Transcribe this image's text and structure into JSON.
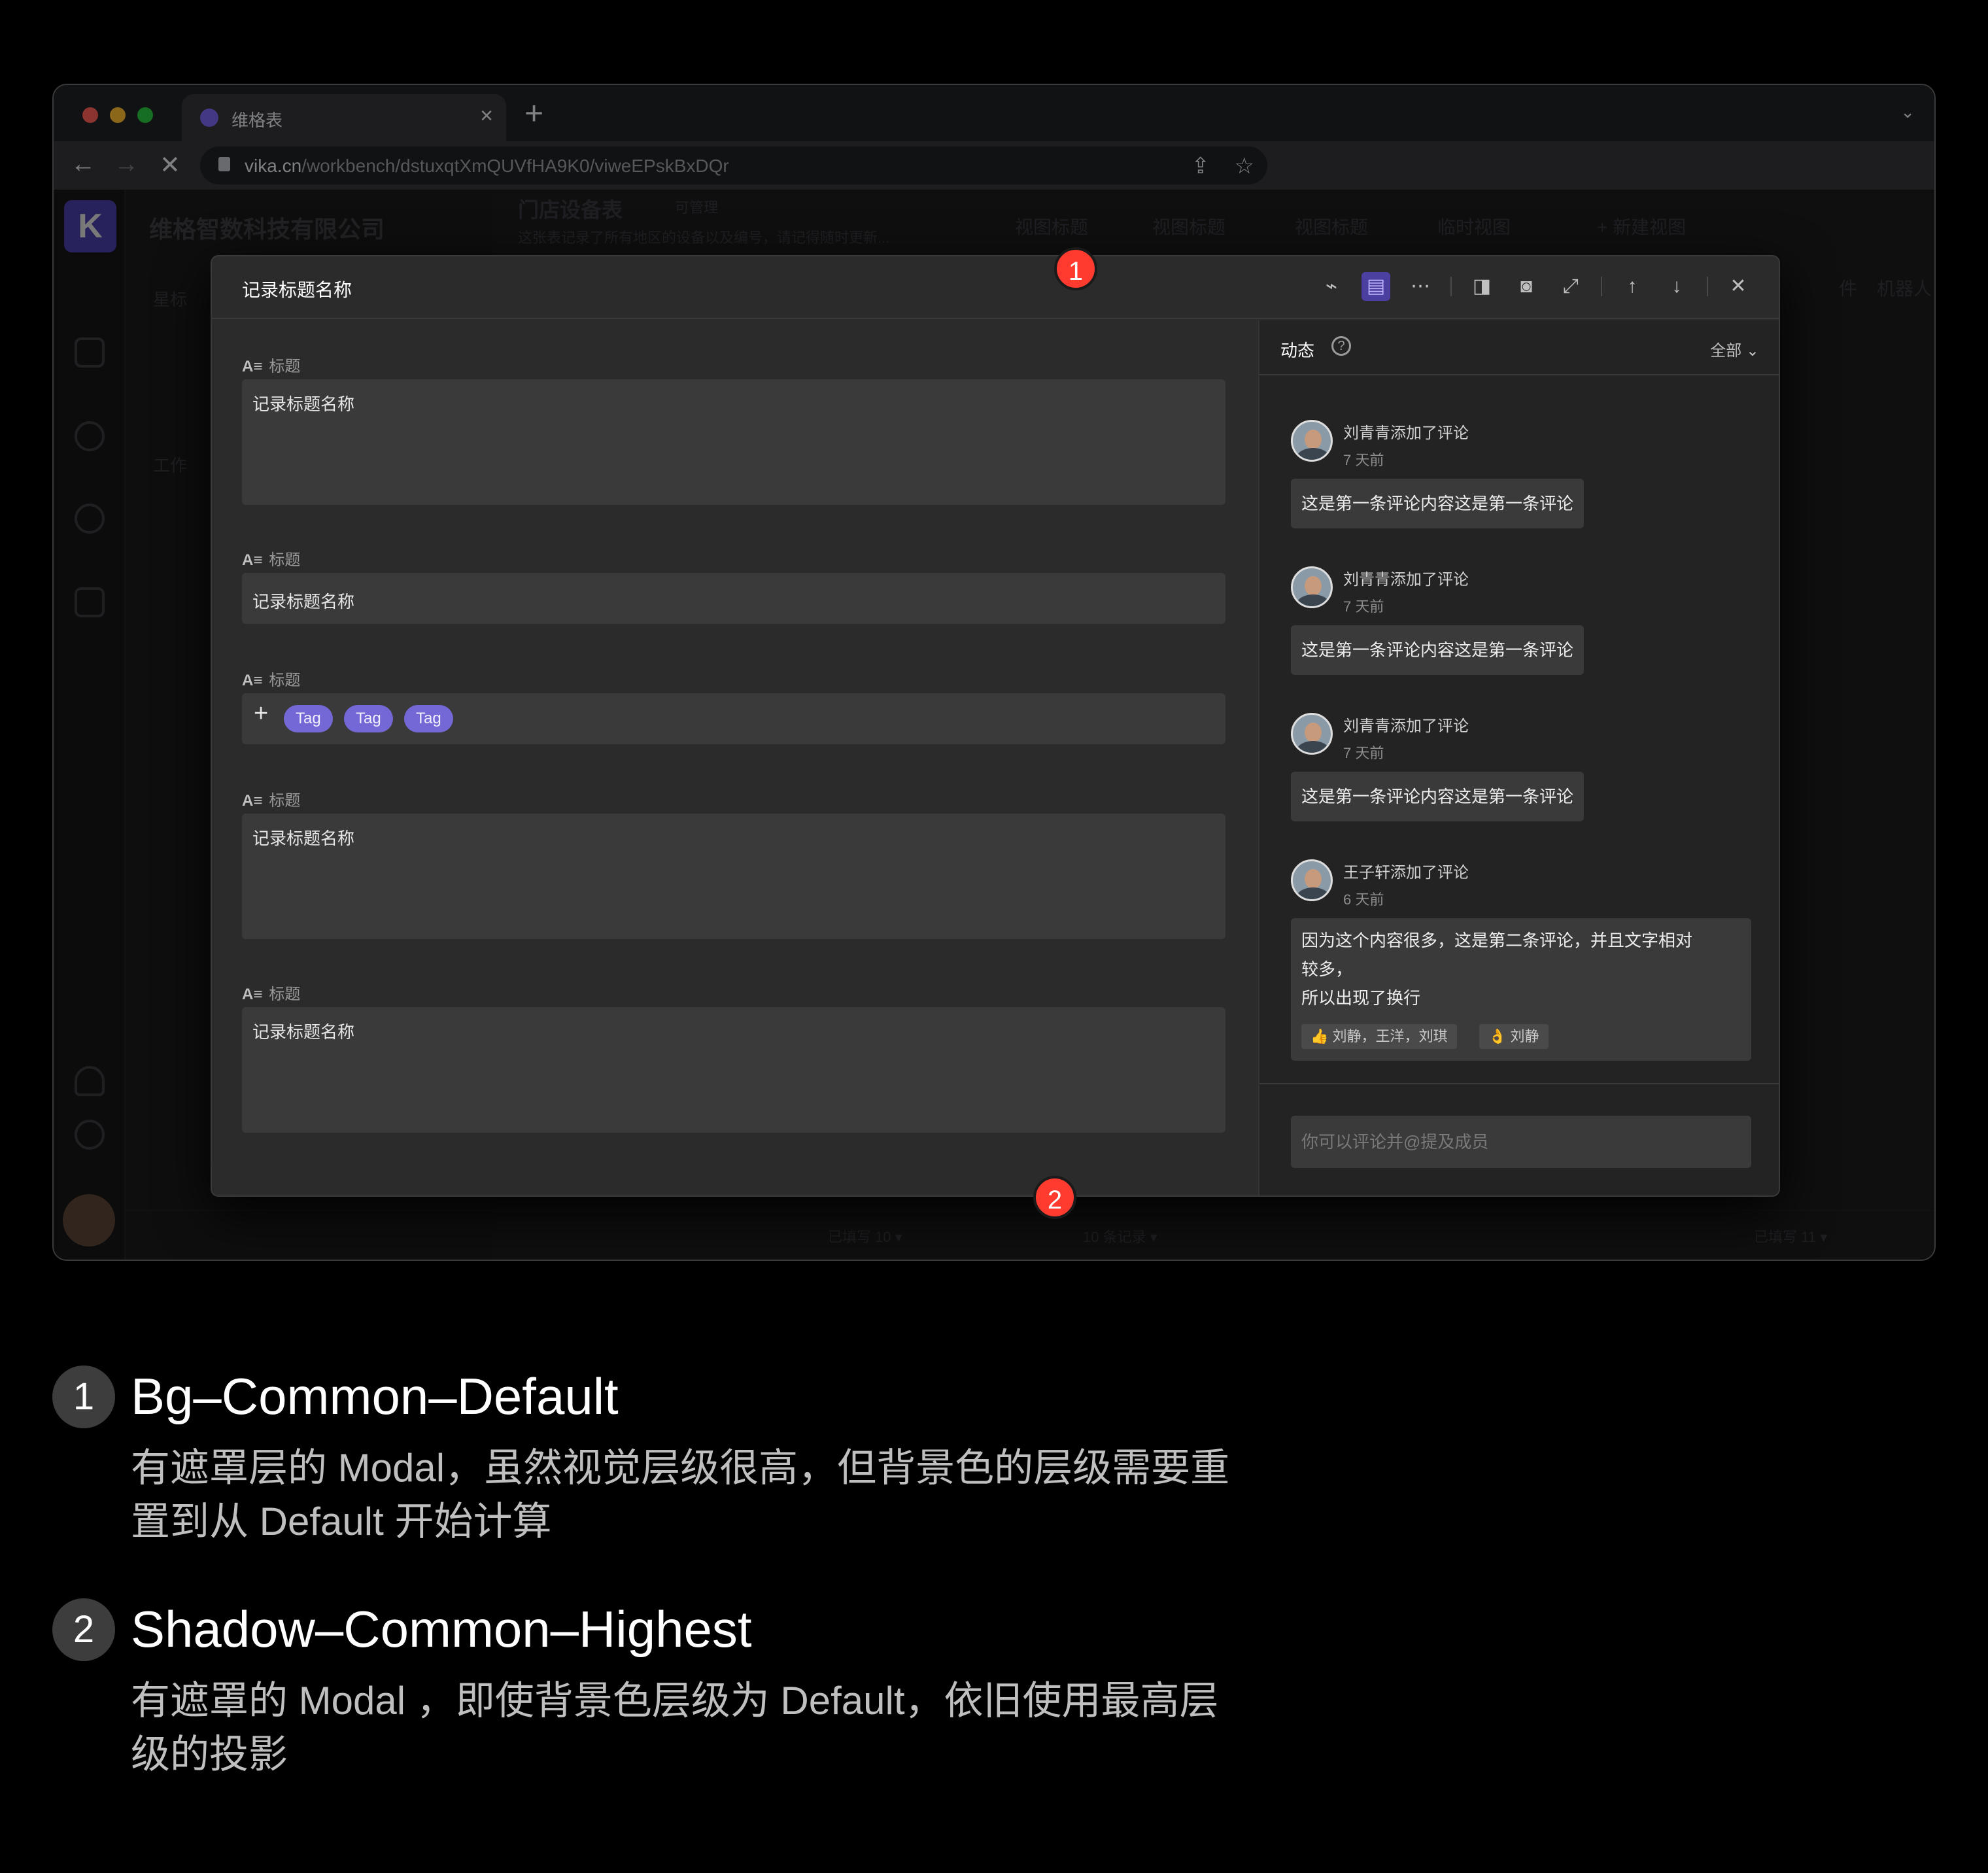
{
  "browser": {
    "tab_title": "维格表",
    "url_host": "vika.cn",
    "url_path": "/workbench/dstuxqtXmQUVfHA9K0/viweEPskBxDQr",
    "light_colors": [
      "#ff5f57",
      "#febc2e",
      "#28c840"
    ]
  },
  "app": {
    "org_name": "维格智数科技有限公司",
    "sidebar_starred": "星标",
    "sidebar_workspace": "工作",
    "sheet_title": "门店设备表",
    "sheet_permission": "可管理",
    "sheet_desc": "这张表记录了所有地区的设备以及编号，请记得随时更新...",
    "views": [
      "视图标题",
      "视图标题",
      "视图标题",
      "临时视图"
    ],
    "new_view": "+ 新建视图",
    "robot": "机器人",
    "attachment": "件",
    "footer_left": "已填写 10 ▾",
    "footer_mid": "10 条记录 ▾",
    "footer_right": "已填写 11 ▾"
  },
  "modal": {
    "title": "记录标题名称",
    "fields": [
      {
        "label": "标题",
        "value": "记录标题名称"
      },
      {
        "label": "标题",
        "value": "记录标题名称"
      },
      {
        "label": "标题",
        "tags": [
          "Tag",
          "Tag",
          "Tag"
        ]
      },
      {
        "label": "标题",
        "value": "记录标题名称"
      },
      {
        "label": "标题",
        "value": "记录标题名称"
      }
    ],
    "activity": {
      "title": "动态",
      "filter": "全部",
      "comments": [
        {
          "author": "刘青青添加了评论",
          "time": "7 天前",
          "text": "这是第一条评论内容这是第一条评论"
        },
        {
          "author": "刘青青添加了评论",
          "time": "7 天前",
          "text": "这是第一条评论内容这是第一条评论"
        },
        {
          "author": "刘青青添加了评论",
          "time": "7 天前",
          "text": "这是第一条评论内容这是第一条评论"
        },
        {
          "author": "王子轩添加了评论",
          "time": "6 天前",
          "text_lines": [
            "因为这个内容很多，这是第二条评论，并且文字相对",
            "较多，",
            "所以出现了换行"
          ],
          "reactions": [
            {
              "emoji": "👍",
              "names": "刘静，王洋，刘琪"
            },
            {
              "emoji": "👌",
              "names": "刘静"
            }
          ]
        }
      ],
      "input_placeholder": "你可以评论并@提及成员"
    }
  },
  "markers": [
    "1",
    "2"
  ],
  "annotations": [
    {
      "num": "1",
      "title": "Bg–Common–Default",
      "desc_lines": [
        "有遮罩层的 Modal，虽然视觉层级很高，但背景色的层级需要重",
        "置到从 Default 开始计算"
      ]
    },
    {
      "num": "2",
      "title": "Shadow–Common–Highest",
      "desc_lines": [
        "有遮罩的 Modal ，即使背景色层级为 Default，依旧使用最高层",
        "级的投影"
      ]
    }
  ]
}
